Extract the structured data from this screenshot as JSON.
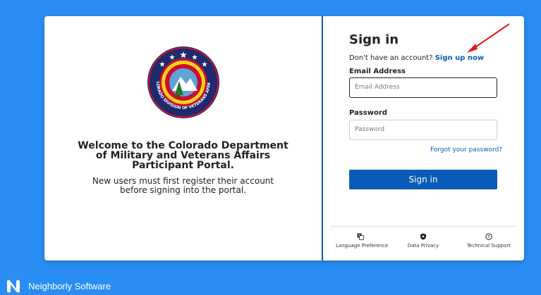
{
  "welcome": {
    "heading": "Welcome to the Colorado Department of Military and Veterans Affairs Participant Portal.",
    "subtext": "New users must first register their account before signing into the portal."
  },
  "seal": {
    "text": "COLORADO DIVISION OF VETERANS AFFAIRS"
  },
  "signin": {
    "title": "Sign in",
    "no_account_text": "Don't have an account?",
    "signup_link": "Sign up now",
    "email_label": "Email Address",
    "email_placeholder": "Email Address",
    "password_label": "Password",
    "password_placeholder": "Password",
    "forgot_link": "Forgot your password?",
    "submit_label": "Sign in"
  },
  "footer": {
    "items": [
      {
        "label": "Language Preference",
        "icon": "language-icon"
      },
      {
        "label": "Data Privacy",
        "icon": "shield-icon"
      },
      {
        "label": "Technical Support",
        "icon": "help-icon"
      }
    ]
  },
  "brand": {
    "name": "Neighborly Software"
  },
  "colors": {
    "background": "#2a8df3",
    "primary": "#0b5cb8"
  }
}
